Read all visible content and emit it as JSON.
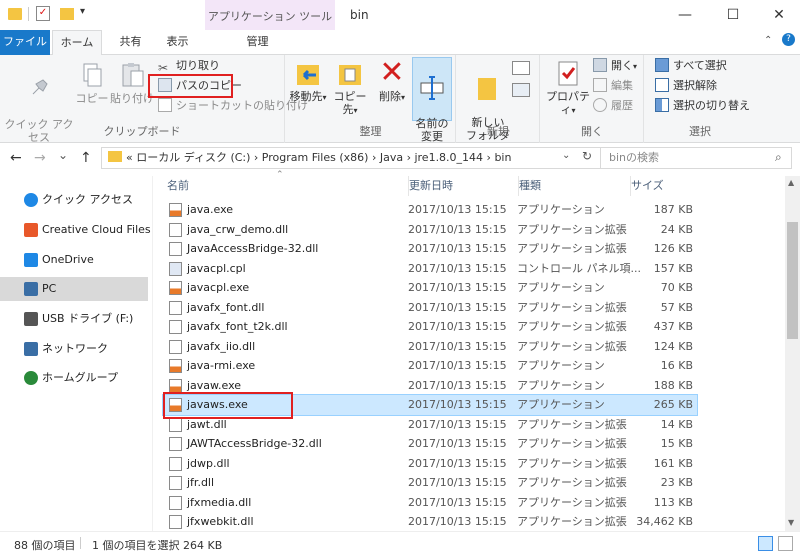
{
  "window": {
    "title": "bin",
    "context_tab_group": "アプリケーション ツール",
    "controls": {
      "minimize": "—",
      "maximize": "☐",
      "close": "✕"
    }
  },
  "tabs": {
    "file": "ファイル",
    "home": "ホーム",
    "share": "共有",
    "view": "表示",
    "manage": "管理"
  },
  "ribbon": {
    "clipboard": {
      "pin_quick_access": "クイック アクセス\nにピン留め",
      "copy": "コピー",
      "paste": "貼り付け",
      "cut": "切り取り",
      "copy_path": "パスのコピー",
      "paste_shortcut": "ショートカットの貼り付け",
      "group_label": "クリップボード"
    },
    "organize": {
      "move_to": "移動先",
      "copy_to": "コピー先",
      "delete": "削除",
      "rename": "名前の\n変更",
      "group_label": "整理"
    },
    "new": {
      "new_folder": "新しい\nフォルダー",
      "group_label": "新規"
    },
    "open": {
      "properties": "プロパティ",
      "open": "開く",
      "edit": "編集",
      "history": "履歴",
      "group_label": "開く"
    },
    "select": {
      "select_all": "すべて選択",
      "select_none": "選択解除",
      "invert": "選択の切り替え",
      "group_label": "選択"
    }
  },
  "address": {
    "back": "←",
    "forward": "→",
    "recent": "⌄",
    "up": "↑",
    "path": "«  ローカル ディスク (C:)  ›  Program Files (x86)  ›  Java  ›  jre1.8.0_144  ›  bin",
    "search_placeholder": "binの検索"
  },
  "nav": [
    {
      "label": "クイック アクセス",
      "icon": "star-icon",
      "color": "#1e88e5"
    },
    {
      "label": "Creative Cloud Files",
      "icon": "creative-cloud-icon",
      "color": "#e8582a"
    },
    {
      "label": "OneDrive",
      "icon": "cloud-icon",
      "color": "#1e88e5"
    },
    {
      "label": "PC",
      "icon": "computer-icon",
      "color": "#3a6ea5"
    },
    {
      "label": "USB ドライブ (F:)",
      "icon": "usb-drive-icon",
      "color": "#555555"
    },
    {
      "label": "ネットワーク",
      "icon": "network-icon",
      "color": "#3a6ea5"
    },
    {
      "label": "ホームグループ",
      "icon": "homegroup-icon",
      "color": "#2a8a3a"
    }
  ],
  "columns": {
    "name": "名前",
    "date": "更新日時",
    "type": "種類",
    "size": "サイズ"
  },
  "files": [
    {
      "name": "java.exe",
      "date": "2017/10/13 15:15",
      "type": "アプリケーション",
      "size": "187 KB"
    },
    {
      "name": "java_crw_demo.dll",
      "date": "2017/10/13 15:15",
      "type": "アプリケーション拡張",
      "size": "24 KB"
    },
    {
      "name": "JavaAccessBridge-32.dll",
      "date": "2017/10/13 15:15",
      "type": "アプリケーション拡張",
      "size": "126 KB"
    },
    {
      "name": "javacpl.cpl",
      "date": "2017/10/13 15:15",
      "type": "コントロール パネル項...",
      "size": "157 KB"
    },
    {
      "name": "javacpl.exe",
      "date": "2017/10/13 15:15",
      "type": "アプリケーション",
      "size": "70 KB"
    },
    {
      "name": "javafx_font.dll",
      "date": "2017/10/13 15:15",
      "type": "アプリケーション拡張",
      "size": "57 KB"
    },
    {
      "name": "javafx_font_t2k.dll",
      "date": "2017/10/13 15:15",
      "type": "アプリケーション拡張",
      "size": "437 KB"
    },
    {
      "name": "javafx_iio.dll",
      "date": "2017/10/13 15:15",
      "type": "アプリケーション拡張",
      "size": "124 KB"
    },
    {
      "name": "java-rmi.exe",
      "date": "2017/10/13 15:15",
      "type": "アプリケーション",
      "size": "16 KB"
    },
    {
      "name": "javaw.exe",
      "date": "2017/10/13 15:15",
      "type": "アプリケーション",
      "size": "188 KB"
    },
    {
      "name": "javaws.exe",
      "date": "2017/10/13 15:15",
      "type": "アプリケーション",
      "size": "265 KB"
    },
    {
      "name": "jawt.dll",
      "date": "2017/10/13 15:15",
      "type": "アプリケーション拡張",
      "size": "14 KB"
    },
    {
      "name": "JAWTAccessBridge-32.dll",
      "date": "2017/10/13 15:15",
      "type": "アプリケーション拡張",
      "size": "15 KB"
    },
    {
      "name": "jdwp.dll",
      "date": "2017/10/13 15:15",
      "type": "アプリケーション拡張",
      "size": "161 KB"
    },
    {
      "name": "jfr.dll",
      "date": "2017/10/13 15:15",
      "type": "アプリケーション拡張",
      "size": "23 KB"
    },
    {
      "name": "jfxmedia.dll",
      "date": "2017/10/13 15:15",
      "type": "アプリケーション拡張",
      "size": "113 KB"
    },
    {
      "name": "jfxwebkit.dll",
      "date": "2017/10/13 15:15",
      "type": "アプリケーション拡張",
      "size": "34,462 KB"
    }
  ],
  "selected_file": "javaws.exe",
  "status": {
    "count": "88 個の項目",
    "selection": "1 個の項目を選択  264 KB"
  },
  "colors": {
    "accent": "#1979ca",
    "selection_bg": "#cce8ff",
    "selection_border": "#99d1ff",
    "highlight_red": "#e02020",
    "context_tab": "#f3e6f8"
  }
}
